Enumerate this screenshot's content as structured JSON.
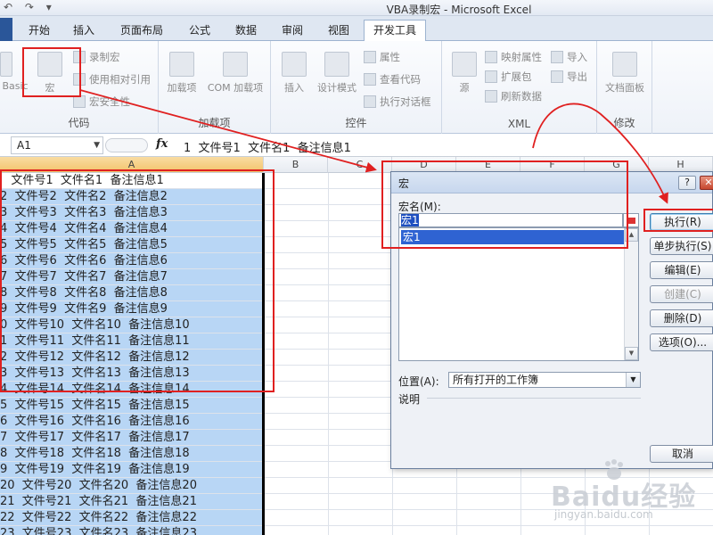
{
  "window": {
    "title": "VBA录制宏 - Microsoft Excel",
    "qat": [
      "↶",
      "↷",
      "▾"
    ]
  },
  "tabs": [
    "开始",
    "插入",
    "页面布局",
    "公式",
    "数据",
    "审阅",
    "视图",
    "开发工具"
  ],
  "active_tab": "开发工具",
  "ribbon": {
    "code_group": {
      "label": "代码",
      "visual_basic": "Basic",
      "macros": "宏",
      "record_macro": "录制宏",
      "relative_ref": "使用相对引用",
      "macro_security": "宏安全性"
    },
    "addins_group": {
      "label": "加载项",
      "addins": "加载项",
      "com_addins": "COM 加载项"
    },
    "controls_group": {
      "label": "控件",
      "insert": "插入",
      "design_mode": "设计模式",
      "properties": "属性",
      "view_code": "查看代码",
      "run_dialog": "执行对话框"
    },
    "xml_group": {
      "label": "XML",
      "source": "源",
      "map_properties": "映射属性",
      "expansion_packs": "扩展包",
      "refresh_data": "刷新数据",
      "import": "导入",
      "export": "导出"
    },
    "modify_group": {
      "label": "修改",
      "doc_panel": "文档面板"
    }
  },
  "formula_bar": {
    "name_box": "A1",
    "fx": "fx",
    "content": "1  文件号1  文件名1  备注信息1"
  },
  "columns": [
    "A",
    "B",
    "C",
    "D",
    "E",
    "F",
    "G",
    "H"
  ],
  "rows": [
    "   文件号1  文件名1  备注信息1",
    "2  文件号2  文件名2  备注信息2",
    "3  文件号3  文件名3  备注信息3",
    "4  文件号4  文件名4  备注信息4",
    "5  文件号5  文件名5  备注信息5",
    "6  文件号6  文件名6  备注信息6",
    "7  文件号7  文件名7  备注信息7",
    "8  文件号8  文件名8  备注信息8",
    "9  文件号9  文件名9  备注信息9",
    "0  文件号10  文件名10  备注信息10",
    "1  文件号11  文件名11  备注信息11",
    "2  文件号12  文件名12  备注信息12",
    "3  文件号13  文件名13  备注信息13",
    "4  文件号14  文件名14  备注信息14",
    "5  文件号15  文件名15  备注信息15",
    "6  文件号16  文件名16  备注信息16",
    "7  文件号17  文件名17  备注信息17",
    "8  文件号18  文件名18  备注信息18",
    "9  文件号19  文件名19  备注信息19",
    "20  文件号20  文件名20  备注信息20",
    "21  文件号21  文件名21  备注信息21",
    "22  文件号22  文件名22  备注信息22",
    "23  文件号23  文件名23  备注信息23"
  ],
  "dialog": {
    "title": "宏",
    "help": "?",
    "close": "✕",
    "macro_name_label": "宏名(M):",
    "macro_name_value": "宏1",
    "macro_list": [
      "宏1"
    ],
    "buttons": {
      "run": "执行(R)",
      "step_into": "单步执行(S)",
      "edit": "编辑(E)",
      "create": "创建(C)",
      "delete": "删除(D)",
      "options": "选项(O)...",
      "cancel": "取消"
    },
    "location_label": "位置(A):",
    "location_value": "所有打开的工作簿",
    "description_label": "说明"
  },
  "watermark": {
    "main": "Baidu经验",
    "sub": "jingyan.baidu.com"
  },
  "colors": {
    "annotation": "#e02020",
    "selection_fill": "#b8d6f5",
    "list_highlight": "#2f63d2"
  }
}
